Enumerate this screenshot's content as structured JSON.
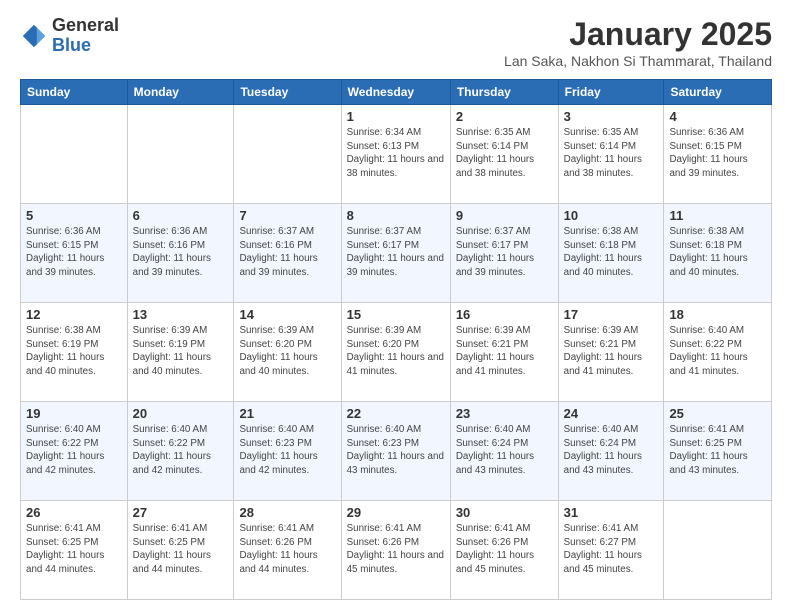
{
  "logo": {
    "general": "General",
    "blue": "Blue"
  },
  "header": {
    "month": "January 2025",
    "location": "Lan Saka, Nakhon Si Thammarat, Thailand"
  },
  "weekdays": [
    "Sunday",
    "Monday",
    "Tuesday",
    "Wednesday",
    "Thursday",
    "Friday",
    "Saturday"
  ],
  "weeks": [
    [
      null,
      null,
      null,
      {
        "day": "1",
        "sunrise": "6:34 AM",
        "sunset": "6:13 PM",
        "hours": "11 hours and 38 minutes."
      },
      {
        "day": "2",
        "sunrise": "6:35 AM",
        "sunset": "6:14 PM",
        "hours": "11 hours and 38 minutes."
      },
      {
        "day": "3",
        "sunrise": "6:35 AM",
        "sunset": "6:14 PM",
        "hours": "11 hours and 38 minutes."
      },
      {
        "day": "4",
        "sunrise": "6:36 AM",
        "sunset": "6:15 PM",
        "hours": "11 hours and 39 minutes."
      }
    ],
    [
      {
        "day": "5",
        "sunrise": "6:36 AM",
        "sunset": "6:15 PM",
        "hours": "11 hours and 39 minutes."
      },
      {
        "day": "6",
        "sunrise": "6:36 AM",
        "sunset": "6:16 PM",
        "hours": "11 hours and 39 minutes."
      },
      {
        "day": "7",
        "sunrise": "6:37 AM",
        "sunset": "6:16 PM",
        "hours": "11 hours and 39 minutes."
      },
      {
        "day": "8",
        "sunrise": "6:37 AM",
        "sunset": "6:17 PM",
        "hours": "11 hours and 39 minutes."
      },
      {
        "day": "9",
        "sunrise": "6:37 AM",
        "sunset": "6:17 PM",
        "hours": "11 hours and 39 minutes."
      },
      {
        "day": "10",
        "sunrise": "6:38 AM",
        "sunset": "6:18 PM",
        "hours": "11 hours and 40 minutes."
      },
      {
        "day": "11",
        "sunrise": "6:38 AM",
        "sunset": "6:18 PM",
        "hours": "11 hours and 40 minutes."
      }
    ],
    [
      {
        "day": "12",
        "sunrise": "6:38 AM",
        "sunset": "6:19 PM",
        "hours": "11 hours and 40 minutes."
      },
      {
        "day": "13",
        "sunrise": "6:39 AM",
        "sunset": "6:19 PM",
        "hours": "11 hours and 40 minutes."
      },
      {
        "day": "14",
        "sunrise": "6:39 AM",
        "sunset": "6:20 PM",
        "hours": "11 hours and 40 minutes."
      },
      {
        "day": "15",
        "sunrise": "6:39 AM",
        "sunset": "6:20 PM",
        "hours": "11 hours and 41 minutes."
      },
      {
        "day": "16",
        "sunrise": "6:39 AM",
        "sunset": "6:21 PM",
        "hours": "11 hours and 41 minutes."
      },
      {
        "day": "17",
        "sunrise": "6:39 AM",
        "sunset": "6:21 PM",
        "hours": "11 hours and 41 minutes."
      },
      {
        "day": "18",
        "sunrise": "6:40 AM",
        "sunset": "6:22 PM",
        "hours": "11 hours and 41 minutes."
      }
    ],
    [
      {
        "day": "19",
        "sunrise": "6:40 AM",
        "sunset": "6:22 PM",
        "hours": "11 hours and 42 minutes."
      },
      {
        "day": "20",
        "sunrise": "6:40 AM",
        "sunset": "6:22 PM",
        "hours": "11 hours and 42 minutes."
      },
      {
        "day": "21",
        "sunrise": "6:40 AM",
        "sunset": "6:23 PM",
        "hours": "11 hours and 42 minutes."
      },
      {
        "day": "22",
        "sunrise": "6:40 AM",
        "sunset": "6:23 PM",
        "hours": "11 hours and 43 minutes."
      },
      {
        "day": "23",
        "sunrise": "6:40 AM",
        "sunset": "6:24 PM",
        "hours": "11 hours and 43 minutes."
      },
      {
        "day": "24",
        "sunrise": "6:40 AM",
        "sunset": "6:24 PM",
        "hours": "11 hours and 43 minutes."
      },
      {
        "day": "25",
        "sunrise": "6:41 AM",
        "sunset": "6:25 PM",
        "hours": "11 hours and 43 minutes."
      }
    ],
    [
      {
        "day": "26",
        "sunrise": "6:41 AM",
        "sunset": "6:25 PM",
        "hours": "11 hours and 44 minutes."
      },
      {
        "day": "27",
        "sunrise": "6:41 AM",
        "sunset": "6:25 PM",
        "hours": "11 hours and 44 minutes."
      },
      {
        "day": "28",
        "sunrise": "6:41 AM",
        "sunset": "6:26 PM",
        "hours": "11 hours and 44 minutes."
      },
      {
        "day": "29",
        "sunrise": "6:41 AM",
        "sunset": "6:26 PM",
        "hours": "11 hours and 45 minutes."
      },
      {
        "day": "30",
        "sunrise": "6:41 AM",
        "sunset": "6:26 PM",
        "hours": "11 hours and 45 minutes."
      },
      {
        "day": "31",
        "sunrise": "6:41 AM",
        "sunset": "6:27 PM",
        "hours": "11 hours and 45 minutes."
      },
      null
    ]
  ]
}
